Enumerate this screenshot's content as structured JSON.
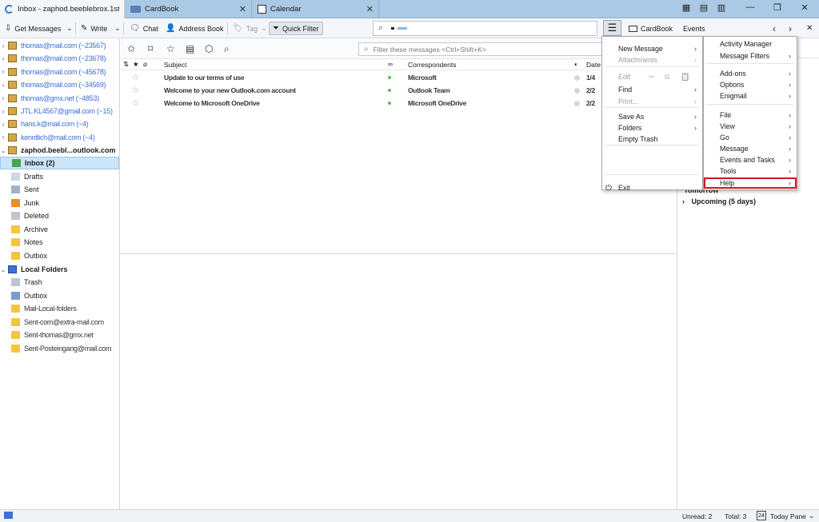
{
  "tabs": [
    {
      "label": "Inbox - zaphod.beeblebrox.1st",
      "icon": "loading-icon"
    },
    {
      "label": "CardBook",
      "icon": "cardbook-icon"
    },
    {
      "label": "Calendar",
      "icon": "calendar-icon"
    }
  ],
  "toolbar": {
    "get_messages": "Get Messages",
    "write": "Write",
    "chat": "Chat",
    "address_book": "Address Book",
    "tag": "Tag",
    "quick_filter": "Quick Filter",
    "cardbook": "CardBook",
    "events": "Events"
  },
  "search": {
    "value": ""
  },
  "filter": {
    "placeholder": "Filter these messages <Ctrl+Shift+K>"
  },
  "columns": {
    "subject": "Subject",
    "correspondents": "Correspondents",
    "date": "Date"
  },
  "messages": [
    {
      "subject": "Update to our terms of use",
      "from": "Microsoft",
      "date": "1/4"
    },
    {
      "subject": "Welcome to your new Outlook.com account",
      "from": "Outlook Team",
      "date": "2/2"
    },
    {
      "subject": "Welcome to Microsoft OneDrive",
      "from": "Microsoft OneDrive",
      "date": "2/2"
    }
  ],
  "accounts_blurred": [
    "thomas@mail.com (~23567)",
    "thomas@mail.com (~23678)",
    "thomas@mail.com (~45678)",
    "thomas@mail.com (~34569)",
    "thomas@gmx.net (~4853)",
    "JTL.KL4567@gmail.com (~15)",
    "hans.k@mail.com (~4)",
    "kenntlich@mail.com (~4)"
  ],
  "account": {
    "name": "zaphod.beebl...outlook.com"
  },
  "folders": [
    {
      "label": "Inbox (2)",
      "bold": true,
      "selected": true,
      "icon": "inbox-icon"
    },
    {
      "label": "Drafts",
      "icon": "drafts-icon"
    },
    {
      "label": "Sent",
      "icon": "sent-icon"
    },
    {
      "label": "Junk",
      "icon": "junk-icon"
    },
    {
      "label": "Deleted",
      "icon": "trash-icon"
    },
    {
      "label": "Archive",
      "icon": "folder-icon"
    },
    {
      "label": "Notes",
      "icon": "folder-icon"
    },
    {
      "label": "Outbox",
      "icon": "folder-icon"
    }
  ],
  "local_folders": {
    "name": "Local Folders",
    "items": [
      {
        "label": "Trash",
        "icon": "trash-icon"
      },
      {
        "label": "Outbox",
        "icon": "outbox-icon"
      }
    ],
    "blurred": [
      "Mail-Local-folders",
      "Sent-com@extra-mail.com",
      "Sent-thomas@gmx.net",
      "Sent-Posteingang@mail.com"
    ]
  },
  "app_menu": {
    "items": [
      {
        "label": "New Message",
        "submenu": true
      },
      {
        "label": "Attachments",
        "submenu": true,
        "disabled": true
      },
      {
        "label": "Edit",
        "disabled": true
      },
      {
        "label": "Find",
        "submenu": true
      },
      {
        "label": "Print...",
        "disabled": true,
        "submenu": true
      },
      {
        "label": "Save As",
        "submenu": true
      },
      {
        "label": "Folders",
        "submenu": true
      },
      {
        "label": "Empty Trash"
      },
      {
        "label": "Exit"
      }
    ]
  },
  "right_menu": {
    "items": [
      {
        "label": "Activity Manager"
      },
      {
        "label": "Message Filters",
        "submenu": true
      },
      {
        "label": "Add-ons",
        "submenu": true
      },
      {
        "label": "Options",
        "submenu": true
      },
      {
        "label": "Enigmail",
        "submenu": true
      },
      {
        "label": "File",
        "submenu": true
      },
      {
        "label": "View",
        "submenu": true
      },
      {
        "label": "Go",
        "submenu": true
      },
      {
        "label": "Message",
        "submenu": true
      },
      {
        "label": "Events and Tasks",
        "submenu": true
      },
      {
        "label": "Tools",
        "submenu": true
      },
      {
        "label": "Help",
        "submenu": true,
        "highlighted": true
      }
    ]
  },
  "today_pane": {
    "tomorrow": "Tomorrow",
    "upcoming": "Upcoming (5 days)"
  },
  "status": {
    "unread": "Unread: 2",
    "total": "Total: 3",
    "today_pane": "Today Pane",
    "today_date": "24"
  },
  "colors": {
    "accent": "#3c6fd8",
    "tabbar": "#aac9e4",
    "selection": "#cce4f7",
    "highlight_box": "#d3171b"
  }
}
